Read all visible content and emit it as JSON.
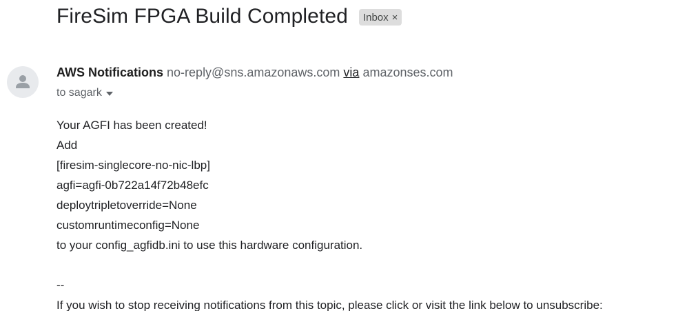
{
  "subject": "FireSim FPGA Build Completed",
  "label": {
    "text": "Inbox",
    "close_glyph": "×"
  },
  "sender": {
    "name": "AWS Notifications",
    "email": "no-reply@sns.amazonaws.com",
    "via": "via",
    "via_domain": "amazonses.com",
    "avatar_icon": "person-icon"
  },
  "recipient": {
    "text": "to sagark"
  },
  "body": {
    "lines": [
      "Your AGFI has been created!",
      "Add",
      "[firesim-singlecore-no-nic-lbp]",
      "agfi=agfi-0b722a14f72b48efc",
      "deploytripletoverride=None",
      "customruntimeconfig=None",
      "to your config_agfidb.ini to use this hardware configuration.",
      "",
      "--",
      "If you wish to stop receiving notifications from this topic, please click or visit the link below to unsubscribe:"
    ]
  },
  "colors": {
    "label_background": "#dddddd",
    "avatar_background": "#e8eaed",
    "avatar_glyph": "#9aa0a6",
    "secondary_text": "#5f6368"
  }
}
